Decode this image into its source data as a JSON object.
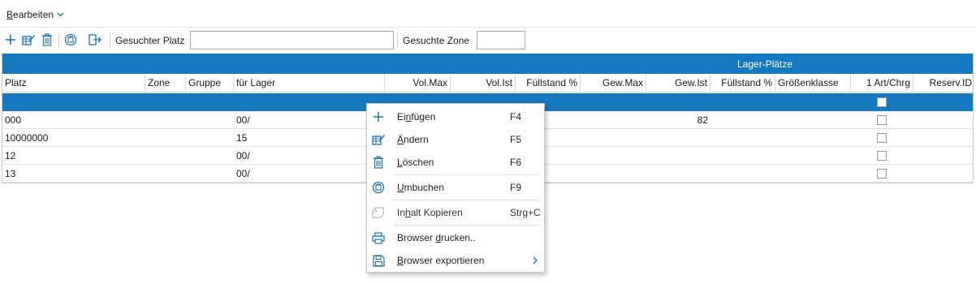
{
  "menubar": {
    "edit_label_first": "B",
    "edit_label_rest": "earbeiten"
  },
  "toolbar": {
    "place_label": "Gesuchter Platz",
    "place_value": "",
    "zone_label": "Gesuchte Zone",
    "zone_value": ""
  },
  "grid": {
    "group_title": "Lager-Plätze",
    "columns": [
      "Platz",
      "Zone",
      "Gruppe",
      "für Lager",
      "Vol.Max",
      "Vol.Ist",
      "Füllstand %",
      "Gew.Max",
      "Gew.Ist",
      "Füllstand %",
      "Größenklasse",
      "1 Art/Chrg",
      "Reserv.ID"
    ],
    "rows": [
      {
        "platz": "",
        "fuer_lager": "",
        "gew_ist": ""
      },
      {
        "platz": "000",
        "fuer_lager": "00/",
        "gew_ist": "82"
      },
      {
        "platz": "10000000",
        "fuer_lager": "15",
        "gew_ist": ""
      },
      {
        "platz": "12",
        "fuer_lager": "00/",
        "gew_ist": ""
      },
      {
        "platz": "13",
        "fuer_lager": "00/",
        "gew_ist": ""
      }
    ]
  },
  "context_menu": {
    "items": [
      {
        "pre": "Ei",
        "u": "n",
        "post": "fügen",
        "shortcut": "F4"
      },
      {
        "pre": "",
        "u": "Ä",
        "post": "ndern",
        "shortcut": "F5"
      },
      {
        "pre": "",
        "u": "L",
        "post": "öschen",
        "shortcut": "F6"
      },
      {
        "pre": "",
        "u": "U",
        "post": "mbuchen",
        "shortcut": "F9"
      },
      {
        "pre": "In",
        "u": "h",
        "post": "alt Kopieren",
        "shortcut": "Strg+C"
      },
      {
        "pre": "Browser ",
        "u": "d",
        "post": "rucken..",
        "shortcut": ""
      },
      {
        "pre": "",
        "u": "B",
        "post": "rowser exportieren",
        "shortcut": ""
      }
    ]
  },
  "colors": {
    "accent": "#1479be",
    "icon_blue": "#1a73b8",
    "disabled_icon": "#b8b8b8"
  }
}
